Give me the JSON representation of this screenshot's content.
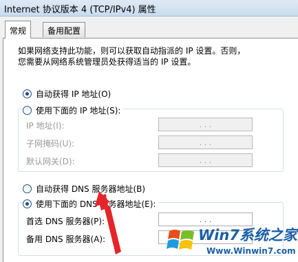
{
  "window": {
    "title": "Internet 协议版本 4 (TCP/IPv4) 属性"
  },
  "tabs": [
    {
      "label": "常规"
    },
    {
      "label": "备用配置"
    }
  ],
  "description": "如果网络支持此功能，则可以获取自动指派的 IP 设置。否则，\n您需要从网络系统管理员处获得适当的 IP 设置。",
  "ip_section": {
    "auto_label": "自动获得 IP 地址(O)",
    "auto_selected": true,
    "manual_label": "使用下面的 IP 地址(S):",
    "manual_selected": false,
    "fields": [
      {
        "label": "IP 地址(I):",
        "value": ". . ."
      },
      {
        "label": "子网掩码(U):",
        "value": ". . ."
      },
      {
        "label": "默认网关(D):",
        "value": ". . ."
      }
    ]
  },
  "dns_section": {
    "auto_label": "自动获得 DNS 服务器地址(B)",
    "auto_selected": false,
    "manual_label": "使用下面的 DNS 服务器地址(E):",
    "manual_selected": true,
    "fields": [
      {
        "label": "首选 DNS 服务器(P):",
        "value": ". . ."
      },
      {
        "label": "备用 DNS 服务器(A):",
        "value": ". . ."
      }
    ]
  },
  "watermark": {
    "title": "Win7系统之家",
    "url": "Www.Winwin7.com"
  },
  "colors": {
    "arrow": "#e5252a",
    "radio_selected": "#1f4a83",
    "watermark": "#1a5fa8"
  }
}
